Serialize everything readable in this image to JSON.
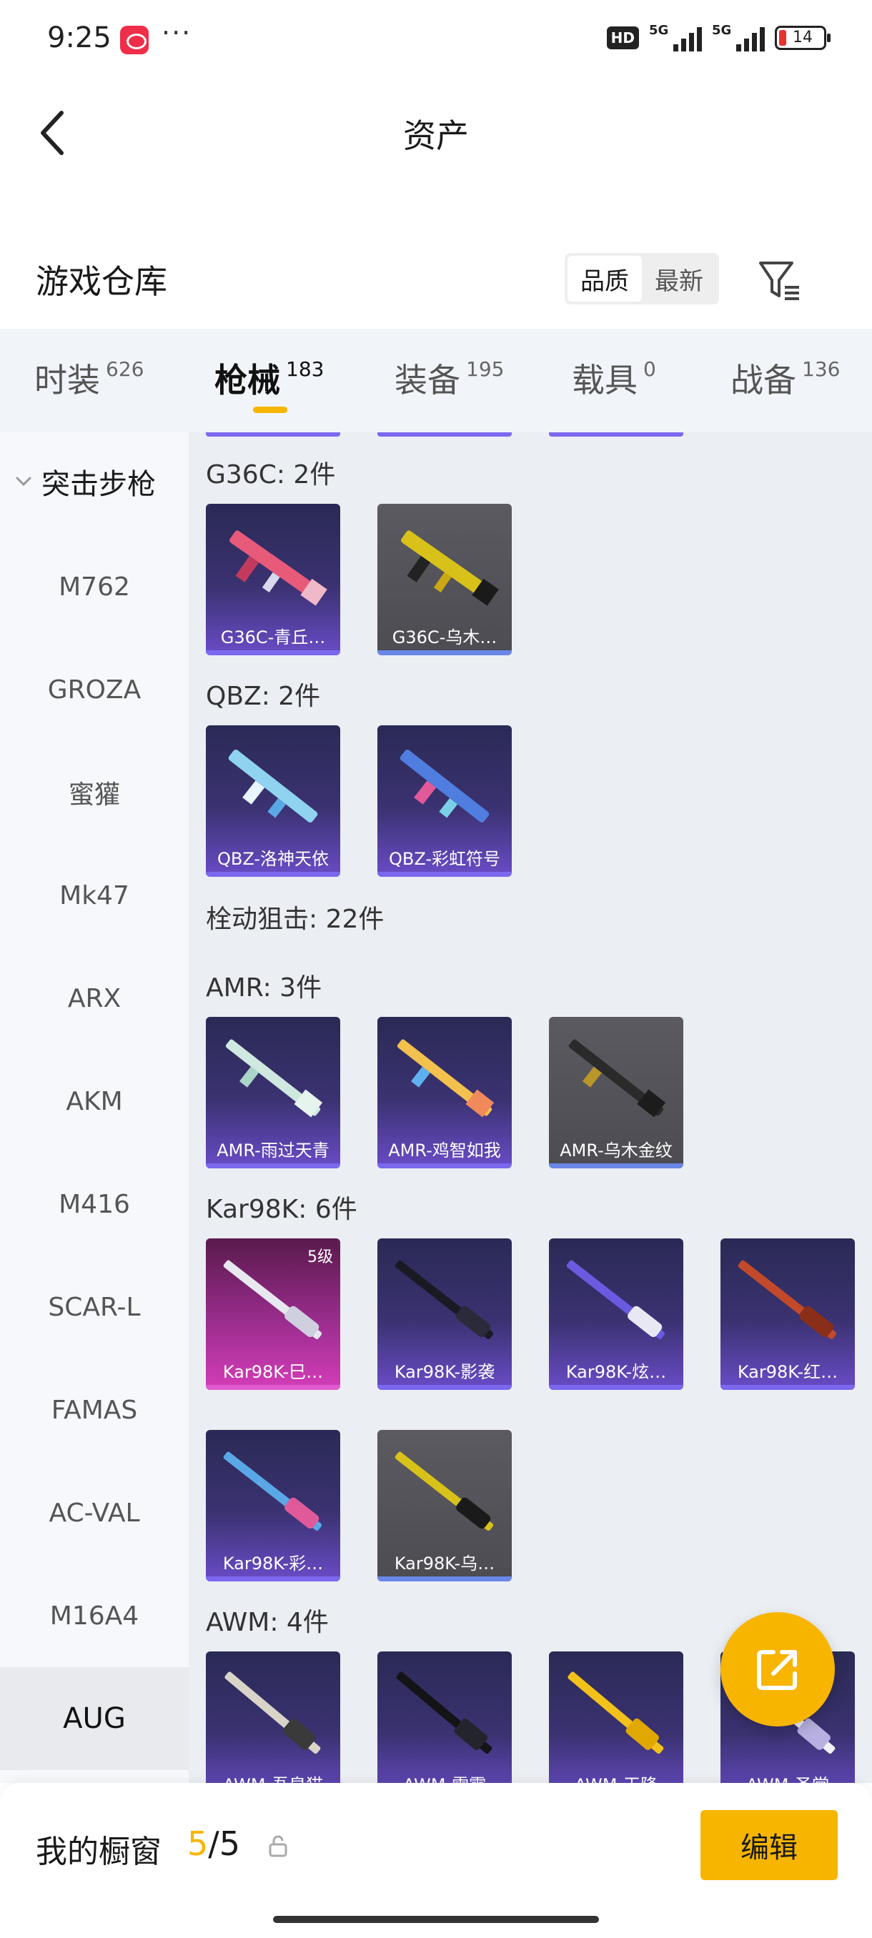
{
  "status": {
    "time": "9:25",
    "more": "···",
    "hd": "HD",
    "net1": "5G",
    "net2": "5G",
    "battery": "14"
  },
  "header": {
    "title": "资产"
  },
  "warehouse": {
    "title": "游戏仓库",
    "sort_quality": "品质",
    "sort_latest": "最新"
  },
  "tabs": [
    {
      "label": "时装",
      "count": "626"
    },
    {
      "label": "枪械",
      "count": "183"
    },
    {
      "label": "装备",
      "count": "195"
    },
    {
      "label": "载具",
      "count": "0"
    },
    {
      "label": "战备",
      "count": "136"
    }
  ],
  "sidebar": {
    "group": "突击步枪",
    "items": [
      "M762",
      "GROZA",
      "蜜獾",
      "Mk47",
      "ARX",
      "AKM",
      "M416",
      "SCAR-L",
      "FAMAS",
      "AC-VAL",
      "M16A4",
      "AUG"
    ]
  },
  "sections": {
    "g36c": {
      "title": "G36C: 2件",
      "items": [
        "G36C-青丘…",
        "G36C-乌木…"
      ]
    },
    "qbz": {
      "title": "QBZ: 2件",
      "items": [
        "QBZ-洛神天依",
        "QBZ-彩虹符号"
      ]
    },
    "bolt": {
      "title": "栓动狙击: 22件"
    },
    "amr": {
      "title": "AMR: 3件",
      "items": [
        "AMR-雨过天青",
        "AMR-鸡智如我",
        "AMR-乌木金纹"
      ]
    },
    "kar98k": {
      "title": "Kar98K: 6件",
      "level": "5级",
      "items": [
        "Kar98K-巳…",
        "Kar98K-影袭",
        "Kar98K-炫…",
        "Kar98K-红…",
        "Kar98K-彩…",
        "Kar98K-乌…"
      ]
    },
    "awm": {
      "title": "AWM: 4件",
      "items": [
        "AWM-吾皇猫",
        "AWM-雷霆",
        "AWM-天降",
        "AWM-圣堂"
      ]
    }
  },
  "showcase": {
    "label": "我的橱窗",
    "used": "5",
    "sep_total": "/5",
    "edit": "编辑"
  }
}
